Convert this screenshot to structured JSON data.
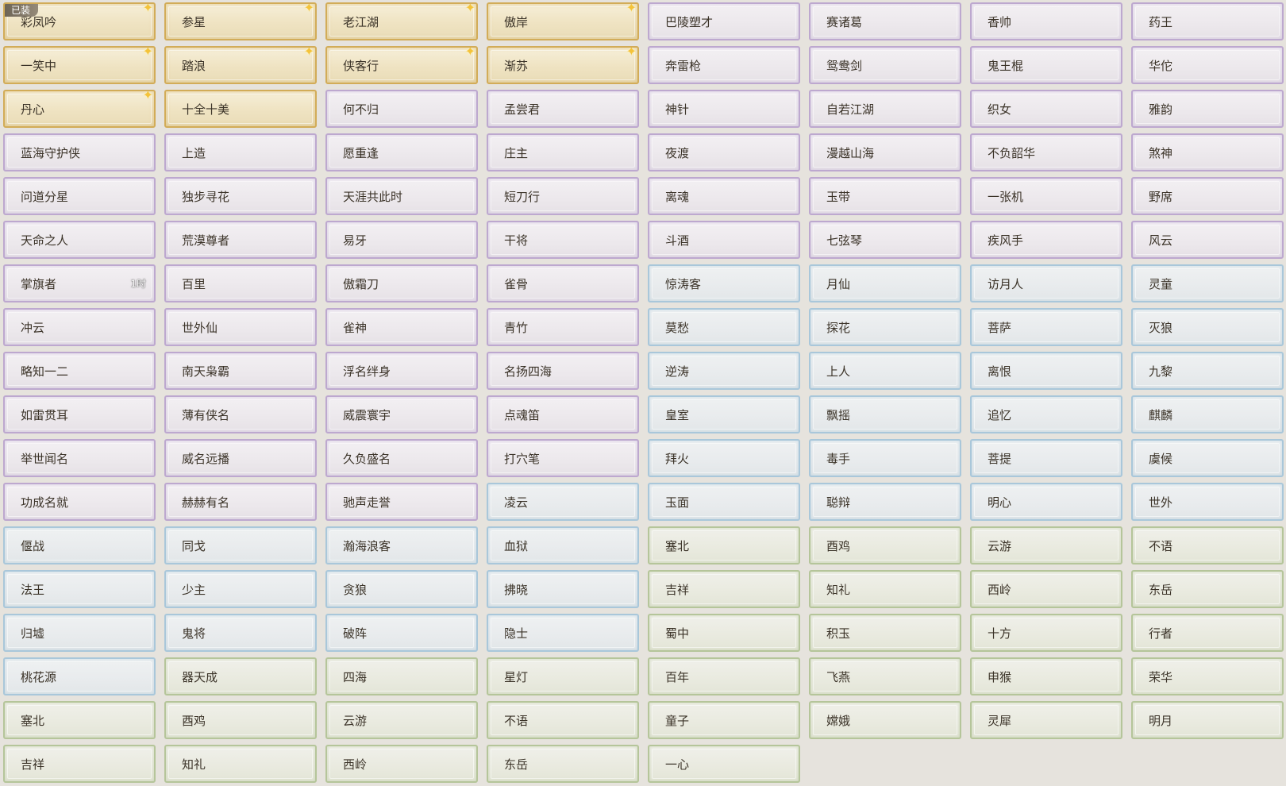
{
  "equipped_badge": "已装",
  "titles": [
    {
      "name": "彩凤吟",
      "rarity": "gold",
      "spark": true,
      "equipped": true
    },
    {
      "name": "参星",
      "rarity": "gold",
      "spark": true
    },
    {
      "name": "老江湖",
      "rarity": "gold",
      "spark": true
    },
    {
      "name": "傲岸",
      "rarity": "gold",
      "spark": true
    },
    {
      "name": "巴陵塑才",
      "rarity": "purple"
    },
    {
      "name": "赛诸葛",
      "rarity": "purple"
    },
    {
      "name": "香帅",
      "rarity": "purple"
    },
    {
      "name": "药王",
      "rarity": "purple"
    },
    {
      "name": "一笑中",
      "rarity": "gold",
      "spark": true
    },
    {
      "name": "踏浪",
      "rarity": "gold",
      "spark": true
    },
    {
      "name": "侠客行",
      "rarity": "gold",
      "spark": true
    },
    {
      "name": "渐苏",
      "rarity": "gold",
      "spark": true
    },
    {
      "name": "奔雷枪",
      "rarity": "purple"
    },
    {
      "name": "鸳鸯剑",
      "rarity": "purple"
    },
    {
      "name": "鬼王棍",
      "rarity": "purple"
    },
    {
      "name": "华佗",
      "rarity": "purple"
    },
    {
      "name": "丹心",
      "rarity": "gold",
      "spark": true
    },
    {
      "name": "十全十美",
      "rarity": "gold"
    },
    {
      "name": "何不归",
      "rarity": "purple"
    },
    {
      "name": "孟尝君",
      "rarity": "purple"
    },
    {
      "name": "神针",
      "rarity": "purple"
    },
    {
      "name": "自若江湖",
      "rarity": "purple"
    },
    {
      "name": "织女",
      "rarity": "purple"
    },
    {
      "name": "雅韵",
      "rarity": "purple"
    },
    {
      "name": "蓝海守护侠",
      "rarity": "purple"
    },
    {
      "name": "上造",
      "rarity": "purple"
    },
    {
      "name": "愿重逢",
      "rarity": "purple"
    },
    {
      "name": "庄主",
      "rarity": "purple"
    },
    {
      "name": "夜渡",
      "rarity": "purple"
    },
    {
      "name": "漫越山海",
      "rarity": "purple"
    },
    {
      "name": "不负韶华",
      "rarity": "purple"
    },
    {
      "name": "煞神",
      "rarity": "purple"
    },
    {
      "name": "问道分星",
      "rarity": "purple"
    },
    {
      "name": "独步寻花",
      "rarity": "purple"
    },
    {
      "name": "天涯共此时",
      "rarity": "purple"
    },
    {
      "name": "短刀行",
      "rarity": "purple"
    },
    {
      "name": "离魂",
      "rarity": "purple"
    },
    {
      "name": "玉带",
      "rarity": "purple"
    },
    {
      "name": "一张机",
      "rarity": "purple"
    },
    {
      "name": "野席",
      "rarity": "purple"
    },
    {
      "name": "天命之人",
      "rarity": "purple"
    },
    {
      "name": "荒漠尊者",
      "rarity": "purple"
    },
    {
      "name": "易牙",
      "rarity": "purple"
    },
    {
      "name": "干将",
      "rarity": "purple"
    },
    {
      "name": "斗酒",
      "rarity": "purple"
    },
    {
      "name": "七弦琴",
      "rarity": "purple"
    },
    {
      "name": "疾风手",
      "rarity": "purple"
    },
    {
      "name": "风云",
      "rarity": "purple"
    },
    {
      "name": "掌旗者",
      "rarity": "purple",
      "timer": "1时"
    },
    {
      "name": "百里",
      "rarity": "purple"
    },
    {
      "name": "傲霜刀",
      "rarity": "purple"
    },
    {
      "name": "雀骨",
      "rarity": "purple"
    },
    {
      "name": "惊涛客",
      "rarity": "blue"
    },
    {
      "name": "月仙",
      "rarity": "blue"
    },
    {
      "name": "访月人",
      "rarity": "blue"
    },
    {
      "name": "灵童",
      "rarity": "blue"
    },
    {
      "name": "冲云",
      "rarity": "purple"
    },
    {
      "name": "世外仙",
      "rarity": "purple"
    },
    {
      "name": "雀神",
      "rarity": "purple"
    },
    {
      "name": "青竹",
      "rarity": "purple"
    },
    {
      "name": "莫愁",
      "rarity": "blue"
    },
    {
      "name": "探花",
      "rarity": "blue"
    },
    {
      "name": "菩萨",
      "rarity": "blue"
    },
    {
      "name": "灭狼",
      "rarity": "blue"
    },
    {
      "name": "略知一二",
      "rarity": "purple"
    },
    {
      "name": "南天枭霸",
      "rarity": "purple"
    },
    {
      "name": "浮名绊身",
      "rarity": "purple"
    },
    {
      "name": "名扬四海",
      "rarity": "purple"
    },
    {
      "name": "逆涛",
      "rarity": "blue"
    },
    {
      "name": "上人",
      "rarity": "blue"
    },
    {
      "name": "离恨",
      "rarity": "blue"
    },
    {
      "name": "九黎",
      "rarity": "blue"
    },
    {
      "name": "如雷贯耳",
      "rarity": "purple"
    },
    {
      "name": "薄有侠名",
      "rarity": "purple"
    },
    {
      "name": "威震寰宇",
      "rarity": "purple"
    },
    {
      "name": "点魂笛",
      "rarity": "purple"
    },
    {
      "name": "皇室",
      "rarity": "blue"
    },
    {
      "name": "飘摇",
      "rarity": "blue"
    },
    {
      "name": "追忆",
      "rarity": "blue"
    },
    {
      "name": "麒麟",
      "rarity": "blue"
    },
    {
      "name": "举世闻名",
      "rarity": "purple"
    },
    {
      "name": "威名远播",
      "rarity": "purple"
    },
    {
      "name": "久负盛名",
      "rarity": "purple"
    },
    {
      "name": "打穴笔",
      "rarity": "purple"
    },
    {
      "name": "拜火",
      "rarity": "blue"
    },
    {
      "name": "毒手",
      "rarity": "blue"
    },
    {
      "name": "菩提",
      "rarity": "blue"
    },
    {
      "name": "虞候",
      "rarity": "blue"
    },
    {
      "name": "功成名就",
      "rarity": "purple"
    },
    {
      "name": "赫赫有名",
      "rarity": "purple"
    },
    {
      "name": "驰声走誉",
      "rarity": "purple"
    },
    {
      "name": "凌云",
      "rarity": "blue"
    },
    {
      "name": "玉面",
      "rarity": "blue"
    },
    {
      "name": "聪辩",
      "rarity": "blue"
    },
    {
      "name": "明心",
      "rarity": "blue"
    },
    {
      "name": "世外",
      "rarity": "blue"
    },
    {
      "name": "偃战",
      "rarity": "blue"
    },
    {
      "name": "同戈",
      "rarity": "blue"
    },
    {
      "name": "瀚海浪客",
      "rarity": "blue"
    },
    {
      "name": "血狱",
      "rarity": "blue"
    },
    {
      "name": "塞北",
      "rarity": "green"
    },
    {
      "name": "酉鸡",
      "rarity": "green"
    },
    {
      "name": "云游",
      "rarity": "green"
    },
    {
      "name": "不语",
      "rarity": "green"
    },
    {
      "name": "法王",
      "rarity": "blue"
    },
    {
      "name": "少主",
      "rarity": "blue"
    },
    {
      "name": "贪狼",
      "rarity": "blue"
    },
    {
      "name": "拂晓",
      "rarity": "blue"
    },
    {
      "name": "吉祥",
      "rarity": "green"
    },
    {
      "name": "知礼",
      "rarity": "green"
    },
    {
      "name": "西岭",
      "rarity": "green"
    },
    {
      "name": "东岳",
      "rarity": "green"
    },
    {
      "name": "归墟",
      "rarity": "blue"
    },
    {
      "name": "鬼将",
      "rarity": "blue"
    },
    {
      "name": "破阵",
      "rarity": "blue"
    },
    {
      "name": "隐士",
      "rarity": "blue"
    },
    {
      "name": "蜀中",
      "rarity": "green"
    },
    {
      "name": "积玉",
      "rarity": "green"
    },
    {
      "name": "十方",
      "rarity": "green"
    },
    {
      "name": "行者",
      "rarity": "green"
    },
    {
      "name": "桃花源",
      "rarity": "blue"
    },
    {
      "name": "器天成",
      "rarity": "green"
    },
    {
      "name": "四海",
      "rarity": "green"
    },
    {
      "name": "星灯",
      "rarity": "green"
    },
    {
      "name": "百年",
      "rarity": "green"
    },
    {
      "name": "飞燕",
      "rarity": "green"
    },
    {
      "name": "申猴",
      "rarity": "green"
    },
    {
      "name": "荣华",
      "rarity": "green"
    },
    {
      "name": "塞北",
      "rarity": "green"
    },
    {
      "name": "酉鸡",
      "rarity": "green"
    },
    {
      "name": "云游",
      "rarity": "green"
    },
    {
      "name": "不语",
      "rarity": "green"
    },
    {
      "name": "童子",
      "rarity": "green"
    },
    {
      "name": "嫦娥",
      "rarity": "green"
    },
    {
      "name": "灵犀",
      "rarity": "green"
    },
    {
      "name": "明月",
      "rarity": "green"
    },
    {
      "name": "吉祥",
      "rarity": "green"
    },
    {
      "name": "知礼",
      "rarity": "green"
    },
    {
      "name": "西岭",
      "rarity": "green"
    },
    {
      "name": "东岳",
      "rarity": "green"
    },
    {
      "name": "一心",
      "rarity": "green"
    }
  ]
}
